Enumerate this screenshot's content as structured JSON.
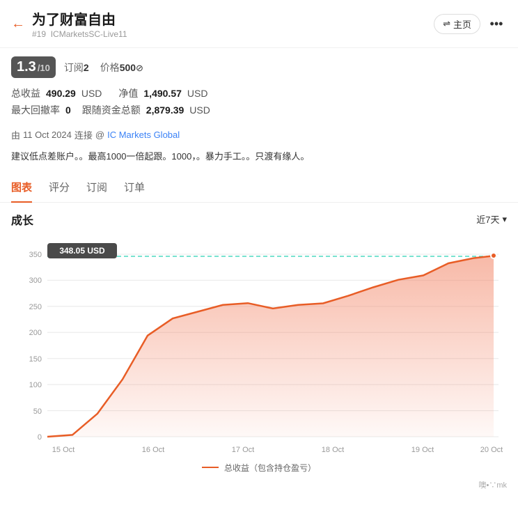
{
  "header": {
    "back_icon": "←",
    "title": "为了财富自由",
    "id_label": "#19",
    "platform": "ICMarketsSC-Live11",
    "home_icon": "⇌",
    "home_label": "主页",
    "more_icon": "•••"
  },
  "rating": {
    "score": "1.3",
    "out_of": "/10",
    "subscribe_label": "订阅",
    "subscribe_count": "2",
    "price_label": "价格",
    "price_value": "500",
    "price_icon": "⊘"
  },
  "stats": {
    "total_profit_label": "总收益",
    "total_profit_value": "490.29",
    "total_profit_unit": "USD",
    "net_value_label": "净值",
    "net_value_value": "1,490.57",
    "net_value_unit": "USD",
    "max_drawdown_label": "最大回撤率",
    "max_drawdown_value": "0",
    "follow_label": "跟随资金总额",
    "follow_value": "2,879.39",
    "follow_unit": "USD"
  },
  "connected": {
    "prefix": "由",
    "date": "11 Oct 2024",
    "connector": "连接",
    "at_sign": "@",
    "provider": "IC Markets Global"
  },
  "description": {
    "text": "建议低点差账户。。最高1000一倍起跟。1000，。暴力手工。。只渡有缘人。"
  },
  "tabs": [
    {
      "id": "chart",
      "label": "图表",
      "active": true
    },
    {
      "id": "rating",
      "label": "评分",
      "active": false
    },
    {
      "id": "subscribe",
      "label": "订阅",
      "active": false
    },
    {
      "id": "orders",
      "label": "订单",
      "active": false
    }
  ],
  "chart": {
    "title": "成长",
    "period": "近7天",
    "period_icon": "▾",
    "tooltip_value": "348.05 USD",
    "y_axis_labels": [
      "350",
      "300",
      "250",
      "200",
      "150",
      "100",
      "50",
      "0"
    ],
    "x_axis_labels": [
      "15 Oct",
      "16 Oct",
      "17 Oct",
      "18 Oct",
      "19 Oct",
      "20 Oct"
    ],
    "legend_line_label": "总收益（包含持仓盈亏）",
    "data_points": [
      0,
      8,
      45,
      110,
      195,
      225,
      240,
      255,
      260,
      248,
      255,
      258,
      270,
      285,
      300,
      310,
      330,
      340,
      348
    ]
  },
  "watermark": {
    "text": "噢•∵mk"
  }
}
